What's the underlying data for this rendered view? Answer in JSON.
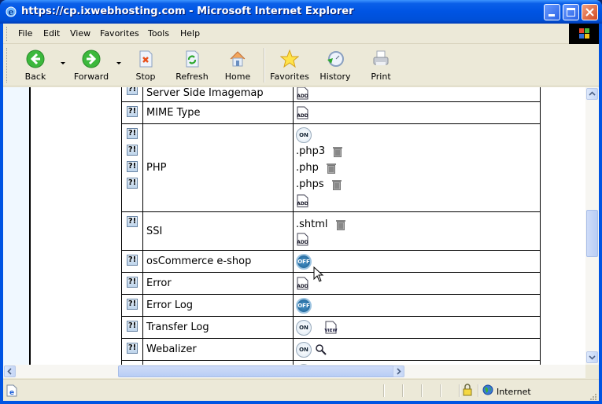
{
  "window": {
    "title": "https://cp.ixwebhosting.com - Microsoft Internet Explorer",
    "controls": [
      "minimize",
      "maximize",
      "close"
    ]
  },
  "menubar": {
    "items": [
      "File",
      "Edit",
      "View",
      "Favorites",
      "Tools",
      "Help"
    ]
  },
  "toolbar": {
    "buttons": [
      {
        "label": "Back",
        "icon": "back-arrow-icon"
      },
      {
        "label": "Forward",
        "icon": "forward-arrow-icon"
      },
      {
        "label": "Stop",
        "icon": "stop-icon"
      },
      {
        "label": "Refresh",
        "icon": "refresh-icon"
      },
      {
        "label": "Home",
        "icon": "home-icon"
      },
      {
        "label": "Favorites",
        "icon": "star-icon"
      },
      {
        "label": "History",
        "icon": "history-icon"
      },
      {
        "label": "Print",
        "icon": "printer-icon"
      }
    ]
  },
  "table": {
    "help_label": "?!",
    "add_label": "ADD",
    "on_label": "ON",
    "off_label": "OFF",
    "view_label": "VIEW",
    "rows": [
      {
        "name": "Server Side Imagemap",
        "status": "add"
      },
      {
        "name": "MIME Type",
        "status": "add"
      },
      {
        "name": "PHP",
        "status": "on",
        "extensions": [
          ".php3",
          ".php",
          ".phps"
        ]
      },
      {
        "name": "SSI",
        "extensions": [
          ".shtml"
        ]
      },
      {
        "name": "osCommerce e-shop",
        "status": "off"
      },
      {
        "name": "Error",
        "status": "add"
      },
      {
        "name": "Error Log",
        "status": "off"
      },
      {
        "name": "Transfer Log",
        "status": "on",
        "action": "view"
      },
      {
        "name": "Webalizer",
        "status": "on",
        "action": "search"
      }
    ]
  },
  "statusbar": {
    "zone": "Internet"
  }
}
